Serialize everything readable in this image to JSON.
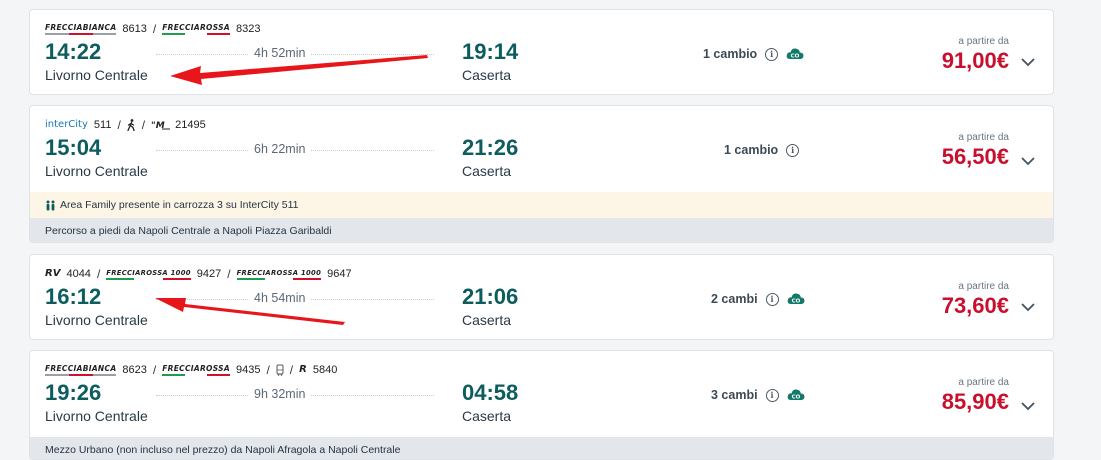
{
  "results": [
    {
      "trains": [
        {
          "brand": "FRECCIABIANCA",
          "number": "8613"
        },
        {
          "brand": "FRECCIAROSSA",
          "number": "8323"
        }
      ],
      "departure_time": "14:22",
      "departure_station": "Livorno Centrale",
      "duration": "4h 52min",
      "arrival_time": "19:14",
      "arrival_station": "Caserta",
      "changes": "1 cambio",
      "price_label": "a partire da",
      "price": "91,00€"
    },
    {
      "trains": [
        {
          "brand": "interCity",
          "number": "511"
        },
        {
          "brand": "walk-icon"
        },
        {
          "brand": "urban-bus-icon",
          "number": "21495"
        }
      ],
      "departure_time": "15:04",
      "departure_station": "Livorno Centrale",
      "duration": "6h 22min",
      "arrival_time": "21:26",
      "arrival_station": "Caserta",
      "changes": "1 cambio",
      "price_label": "a partire da",
      "price": "56,50€",
      "notes": [
        "Area Family presente in carrozza 3 su InterCity 511",
        "Percorso a piedi da Napoli Centrale a Napoli Piazza Garibaldi"
      ]
    },
    {
      "trains": [
        {
          "brand": "RV",
          "number": "4044"
        },
        {
          "brand": "FRECCIAROSSA 1000",
          "number": "9427"
        },
        {
          "brand": "FRECCIAROSSA 1000",
          "number": "9647"
        }
      ],
      "departure_time": "16:12",
      "departure_station": "Livorno Centrale",
      "duration": "4h 54min",
      "arrival_time": "21:06",
      "arrival_station": "Caserta",
      "changes": "2 cambi",
      "price_label": "a partire da",
      "price": "73,60€"
    },
    {
      "trains": [
        {
          "brand": "FRECCIABIANCA",
          "number": "8623"
        },
        {
          "brand": "FRECCIAROSSA",
          "number": "9435"
        },
        {
          "brand": "bus-icon"
        },
        {
          "brand": "R",
          "number": "5840"
        }
      ],
      "departure_time": "19:26",
      "departure_station": "Livorno Centrale",
      "duration": "9h 32min",
      "arrival_time": "04:58",
      "arrival_station": "Caserta",
      "changes": "3 cambi",
      "price_label": "a partire da",
      "price": "85,90€",
      "notes": [
        "Mezzo Urbano (non incluso nel prezzo) da Napoli Afragola a Napoli Centrale"
      ]
    }
  ],
  "colors": {
    "time": "#0d5c5e",
    "price": "#c8102e",
    "annotation_arrow": "#e8161a",
    "family_note_bg": "#fdf6e6",
    "gray_note_bg": "#e3e6ea"
  }
}
